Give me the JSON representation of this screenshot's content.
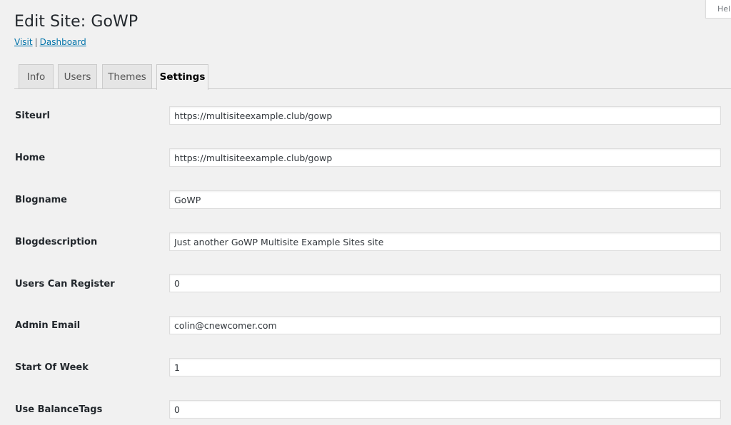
{
  "help": {
    "label": "Help"
  },
  "header": {
    "title": "Edit Site: GoWP",
    "visit_link": "Visit",
    "separator": "|",
    "dashboard_link": "Dashboard"
  },
  "tabs": [
    {
      "label": "Info",
      "active": false
    },
    {
      "label": "Users",
      "active": false
    },
    {
      "label": "Themes",
      "active": false
    },
    {
      "label": "Settings",
      "active": true
    }
  ],
  "settings": [
    {
      "label": "Siteurl",
      "value": "https://multisiteexample.club/gowp"
    },
    {
      "label": "Home",
      "value": "https://multisiteexample.club/gowp"
    },
    {
      "label": "Blogname",
      "value": "GoWP"
    },
    {
      "label": "Blogdescription",
      "value": "Just another GoWP Multisite Example Sites site"
    },
    {
      "label": "Users Can Register",
      "value": "0"
    },
    {
      "label": "Admin Email",
      "value": "colin@cnewcomer.com"
    },
    {
      "label": "Start Of Week",
      "value": "1"
    },
    {
      "label": "Use BalanceTags",
      "value": "0"
    }
  ],
  "colors": {
    "link": "#0073aa",
    "background": "#f1f1f1",
    "tab_inactive": "#e5e5e5"
  }
}
